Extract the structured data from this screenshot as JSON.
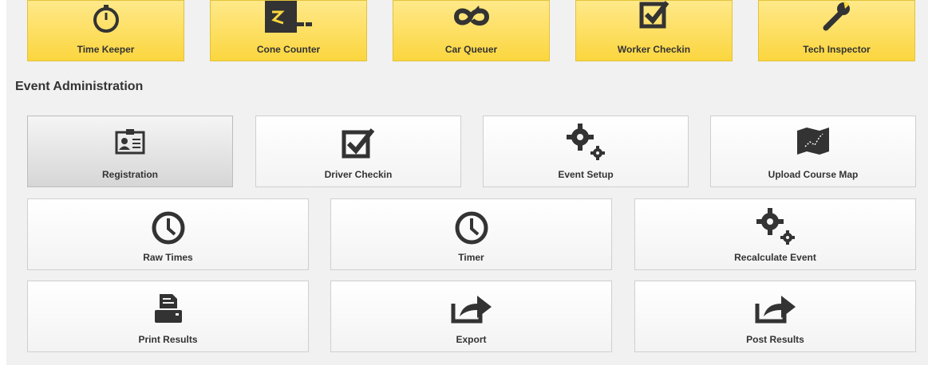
{
  "top_tiles": [
    {
      "label": "Time Keeper",
      "icon": "stopwatch-icon"
    },
    {
      "label": "Cone Counter",
      "icon": "cone-counter-icon"
    },
    {
      "label": "Car Queuer",
      "icon": "loop-icon"
    },
    {
      "label": "Worker Checkin",
      "icon": "checkbox-icon"
    },
    {
      "label": "Tech Inspector",
      "icon": "wrench-icon"
    }
  ],
  "section_title": "Event Administration",
  "admin_row1": [
    {
      "label": "Registration",
      "icon": "id-card-icon"
    },
    {
      "label": "Driver Checkin",
      "icon": "checkbox-icon"
    },
    {
      "label": "Event Setup",
      "icon": "gears-icon"
    },
    {
      "label": "Upload Course Map",
      "icon": "map-icon"
    }
  ],
  "admin_row2": [
    {
      "label": "Raw Times",
      "icon": "clock-icon"
    },
    {
      "label": "Timer",
      "icon": "clock-icon"
    },
    {
      "label": "Recalculate Event",
      "icon": "gears-icon"
    }
  ],
  "admin_row3": [
    {
      "label": "Print Results",
      "icon": "printer-icon"
    },
    {
      "label": "Export",
      "icon": "export-icon"
    },
    {
      "label": "Post Results",
      "icon": "export-icon"
    }
  ],
  "colors": {
    "tile_yellow": "#fbd63f",
    "icon_dark": "#333333",
    "panel_bg": "#f1f1f1"
  }
}
